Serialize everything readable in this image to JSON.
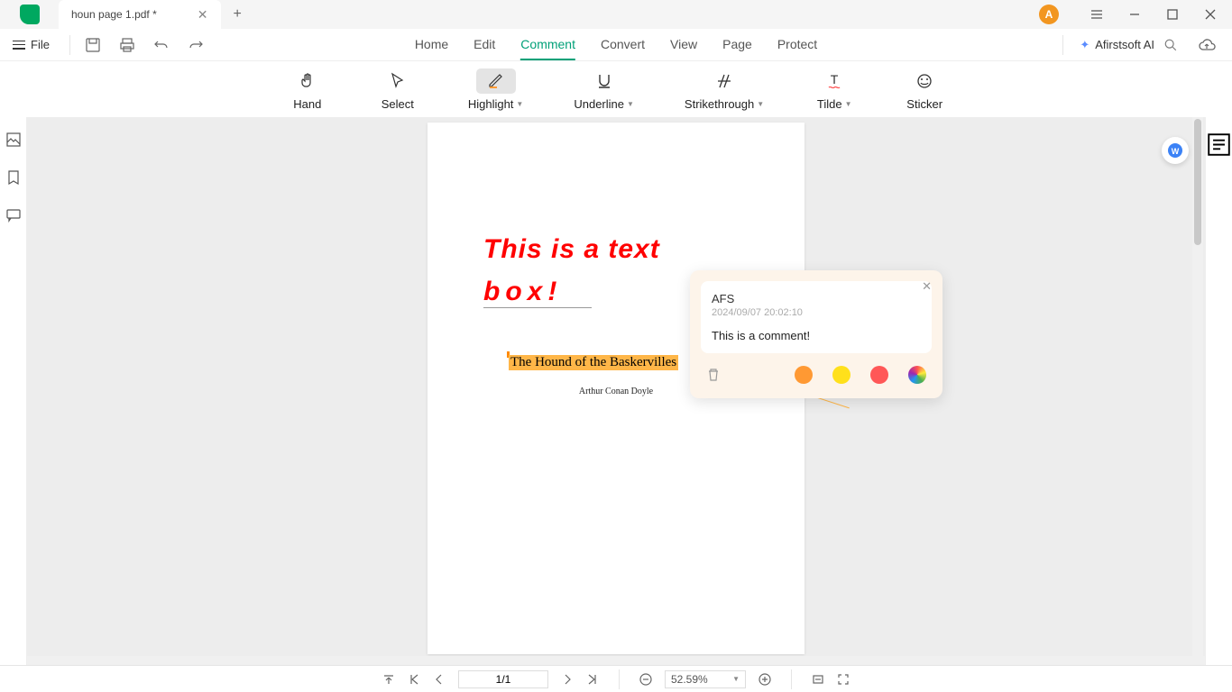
{
  "titlebar": {
    "tab_name": "houn page 1.pdf *",
    "avatar_letter": "A"
  },
  "filerow": {
    "file_label": "File"
  },
  "menubar": {
    "items": [
      "Home",
      "Edit",
      "Comment",
      "Convert",
      "View",
      "Page",
      "Protect"
    ],
    "active_index": 2,
    "ai_label": "Afirstsoft AI"
  },
  "toolbar": {
    "items": [
      {
        "label": "Hand",
        "icon": "hand-icon",
        "dropdown": false
      },
      {
        "label": "Select",
        "icon": "cursor-icon",
        "dropdown": false
      },
      {
        "label": "Highlight",
        "icon": "highlight-icon",
        "dropdown": true,
        "active": true
      },
      {
        "label": "Underline",
        "icon": "underline-icon",
        "dropdown": true
      },
      {
        "label": "Strikethrough",
        "icon": "strikethrough-icon",
        "dropdown": true
      },
      {
        "label": "Tilde",
        "icon": "tilde-icon",
        "dropdown": true
      },
      {
        "label": "Sticker",
        "icon": "sticker-icon",
        "dropdown": false
      }
    ]
  },
  "document": {
    "textbox_line1": "This is a text",
    "textbox_line2": "box!",
    "title": "The Hound of the Baskervilles",
    "author": "Arthur Conan Doyle"
  },
  "comment": {
    "author": "AFS",
    "timestamp": "2024/09/07 20:02:10",
    "body": "This is a comment!",
    "colors": [
      "#ff9933",
      "#ffe01b",
      "#ff5757"
    ]
  },
  "statusbar": {
    "page": "1/1",
    "zoom": "52.59%"
  }
}
